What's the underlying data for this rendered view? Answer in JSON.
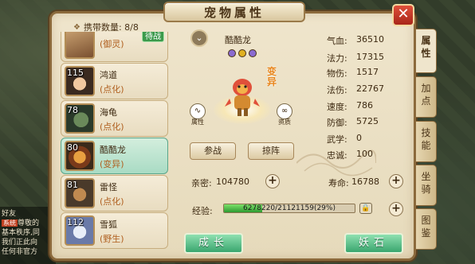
{
  "window": {
    "title": "宠物属性",
    "close_label": "✕"
  },
  "background": {
    "chat_lines": [
      "好友",
      "尊敬的",
      "基本秩序,同",
      "我们正此向",
      "任何非官方"
    ],
    "chat_tag": "系统"
  },
  "pet_list": {
    "carry_label": "携带数量: 8/8",
    "items": [
      {
        "level": "",
        "name": "",
        "type": "(御灵)",
        "carry_tag": "待战",
        "selected": false
      },
      {
        "level": "115",
        "name": "鸿道",
        "type": "(点化)",
        "selected": false
      },
      {
        "level": "78",
        "name": "海龟",
        "type": "(点化)",
        "selected": false
      },
      {
        "level": "80",
        "name": "酷酷龙",
        "type": "(变异)",
        "selected": true
      },
      {
        "level": "81",
        "name": "雷怪",
        "type": "(点化)",
        "selected": false
      },
      {
        "level": "112",
        "name": "雪狐",
        "type": "(野生)",
        "selected": false
      }
    ]
  },
  "pet_detail": {
    "name": "酷酷龙",
    "variant_label": "变异",
    "left_icon": "attribute-icon",
    "left_icon_label": "属性",
    "right_icon": "infinity-icon",
    "right_icon_label": "资质",
    "battle_button": "参战",
    "formation_button": "掠阵",
    "gem_colors": [
      "#8a6ad0",
      "#e0b020",
      "#8a6ad0"
    ]
  },
  "stats": [
    {
      "label": "气血:",
      "value": "36510"
    },
    {
      "label": "法力:",
      "value": "17315"
    },
    {
      "label": "物伤:",
      "value": "1517"
    },
    {
      "label": "法伤:",
      "value": "22767"
    },
    {
      "label": "速度:",
      "value": "786"
    },
    {
      "label": "防御:",
      "value": "5725"
    },
    {
      "label": "武学:",
      "value": "0"
    },
    {
      "label": "忠诚:",
      "value": "100"
    }
  ],
  "intimacy": {
    "label": "亲密:",
    "value": "104780"
  },
  "lifespan": {
    "label": "寿命:",
    "value": "16788"
  },
  "experience": {
    "label": "经验:",
    "text": "6278220/21121159(29%)",
    "fraction": 0.29
  },
  "actions": {
    "grow_button": "成长",
    "demon_stone_button": "妖石"
  },
  "tabs": [
    {
      "label": "属\n性",
      "active": true
    },
    {
      "label": "加\n点",
      "active": false
    },
    {
      "label": "技\n能",
      "active": false
    },
    {
      "label": "坐\n骑",
      "active": false
    },
    {
      "label": "图\n鉴",
      "active": false
    }
  ],
  "colors": {
    "frame": "#8c6a3c",
    "panel": "#efe5cc",
    "selected_row": "#a9dbc4",
    "accent_green": "#3aa66e",
    "close_red": "#c03020",
    "variant_orange": "#e8861c"
  }
}
